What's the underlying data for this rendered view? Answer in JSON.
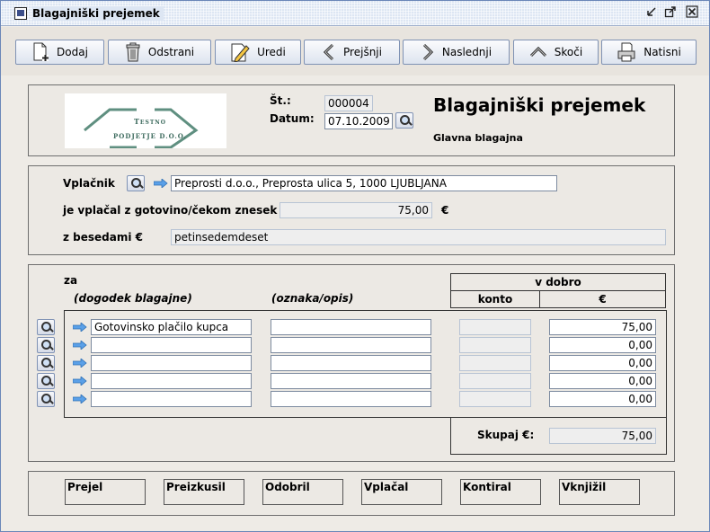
{
  "window": {
    "title": "Blagajniški prejemek",
    "controls": [
      "minimize-icon",
      "maximize-icon",
      "close-icon"
    ]
  },
  "toolbar": {
    "buttons": [
      {
        "label": "Dodaj",
        "icon": "add-document-icon"
      },
      {
        "label": "Odstrani",
        "icon": "trash-icon"
      },
      {
        "label": "Uredi",
        "icon": "edit-icon"
      },
      {
        "label": "Prejšnji",
        "icon": "previous-icon"
      },
      {
        "label": "Naslednji",
        "icon": "next-icon"
      },
      {
        "label": "Skoči",
        "icon": "jump-icon"
      },
      {
        "label": "Natisni",
        "icon": "print-icon"
      }
    ]
  },
  "header": {
    "logo_line1": "Testno",
    "logo_line2": "podjetje d.o.o.",
    "number_label": "Št.:",
    "number_value": "000004",
    "date_label": "Datum:",
    "date_value": "07.10.2009",
    "doc_title": "Blagajniški prejemek",
    "cash_register": "Glavna blagajna"
  },
  "payer": {
    "payer_label": "Vplačnik",
    "payer_value": "Preprosti d.o.o., Preprosta ulica 5, 1000 LJUBLJANA",
    "amount_label": "je vplačal z gotovino/čekom znesek",
    "amount_value": "75,00",
    "currency": "€",
    "words_label": "z besedami €",
    "words_value": "petinsedemdeset"
  },
  "items": {
    "for_label": "za",
    "col_event": "(dogodek blagajne)",
    "col_desc": "(oznaka/opis)",
    "credit_header": "v dobro",
    "col_account": "konto",
    "col_amount": "€",
    "rows": [
      {
        "event": "Gotovinsko plačilo kupca",
        "desc": "",
        "account": "",
        "amount": "75,00"
      },
      {
        "event": "",
        "desc": "",
        "account": "",
        "amount": "0,00"
      },
      {
        "event": "",
        "desc": "",
        "account": "",
        "amount": "0,00"
      },
      {
        "event": "",
        "desc": "",
        "account": "",
        "amount": "0,00"
      },
      {
        "event": "",
        "desc": "",
        "account": "",
        "amount": "0,00"
      }
    ],
    "total_label": "Skupaj €:",
    "total_value": "75,00"
  },
  "signatures": [
    "Prejel",
    "Preizkusil",
    "Odobril",
    "Vplačal",
    "Kontiral",
    "Vknjižil"
  ]
}
